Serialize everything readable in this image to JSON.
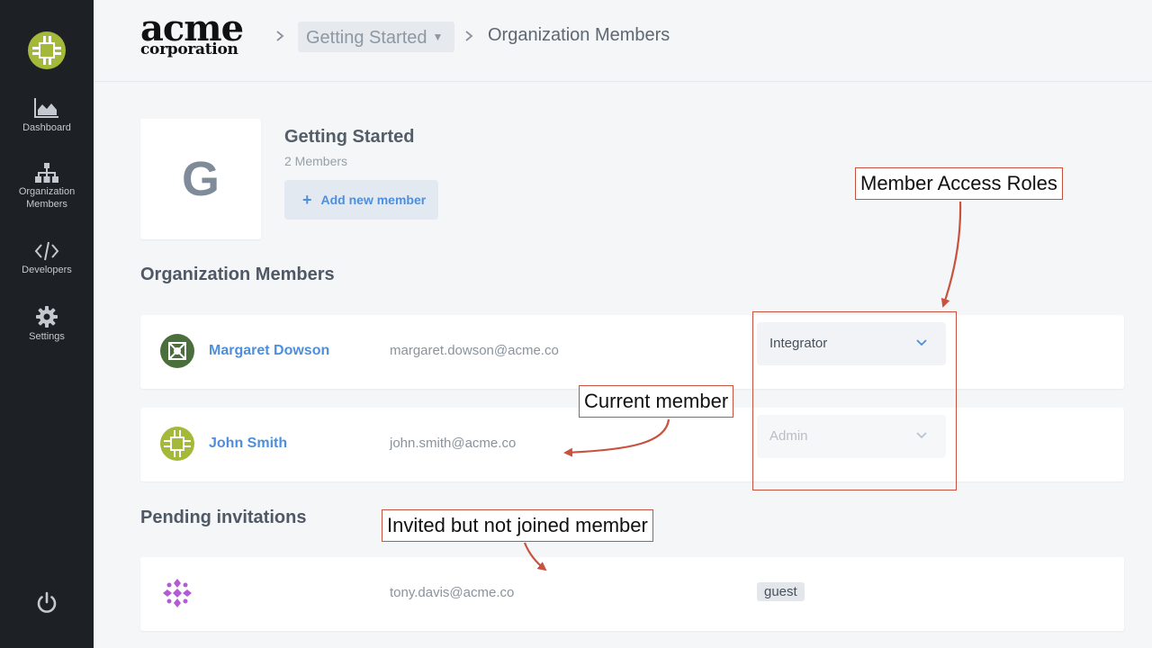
{
  "sidebar": {
    "items": [
      {
        "label": "Dashboard",
        "icon": "chart-icon"
      },
      {
        "label": "Organization\nMembers",
        "icon": "org-chart-icon"
      },
      {
        "label": "Developers",
        "icon": "code-icon"
      },
      {
        "label": "Settings",
        "icon": "gear-icon"
      }
    ],
    "power_icon": "power-icon"
  },
  "header": {
    "brand_top": "acme",
    "brand_bottom": "corporation",
    "breadcrumb_project": "Getting Started",
    "breadcrumb_current": "Organization Members"
  },
  "org": {
    "initial": "G",
    "name": "Getting Started",
    "member_count": "2 Members",
    "add_member_label": "Add new member"
  },
  "members_section": {
    "title": "Organization Members",
    "members": [
      {
        "name": "Margaret Dowson",
        "email": "margaret.dowson@acme.co",
        "role": "Integrator",
        "role_disabled": false
      },
      {
        "name": "John Smith",
        "email": "john.smith@acme.co",
        "role": "Admin",
        "role_disabled": true
      }
    ]
  },
  "pending_section": {
    "title": "Pending invitations",
    "invitations": [
      {
        "email": "tony.davis@acme.co",
        "role": "guest"
      }
    ]
  },
  "annotations": {
    "roles": "Member Access Roles",
    "current": "Current member",
    "invited": "Invited but not joined member"
  },
  "colors": {
    "sidebar_bg": "#1d2125",
    "accent": "#4d8fdc",
    "annotation": "#c9523f"
  }
}
